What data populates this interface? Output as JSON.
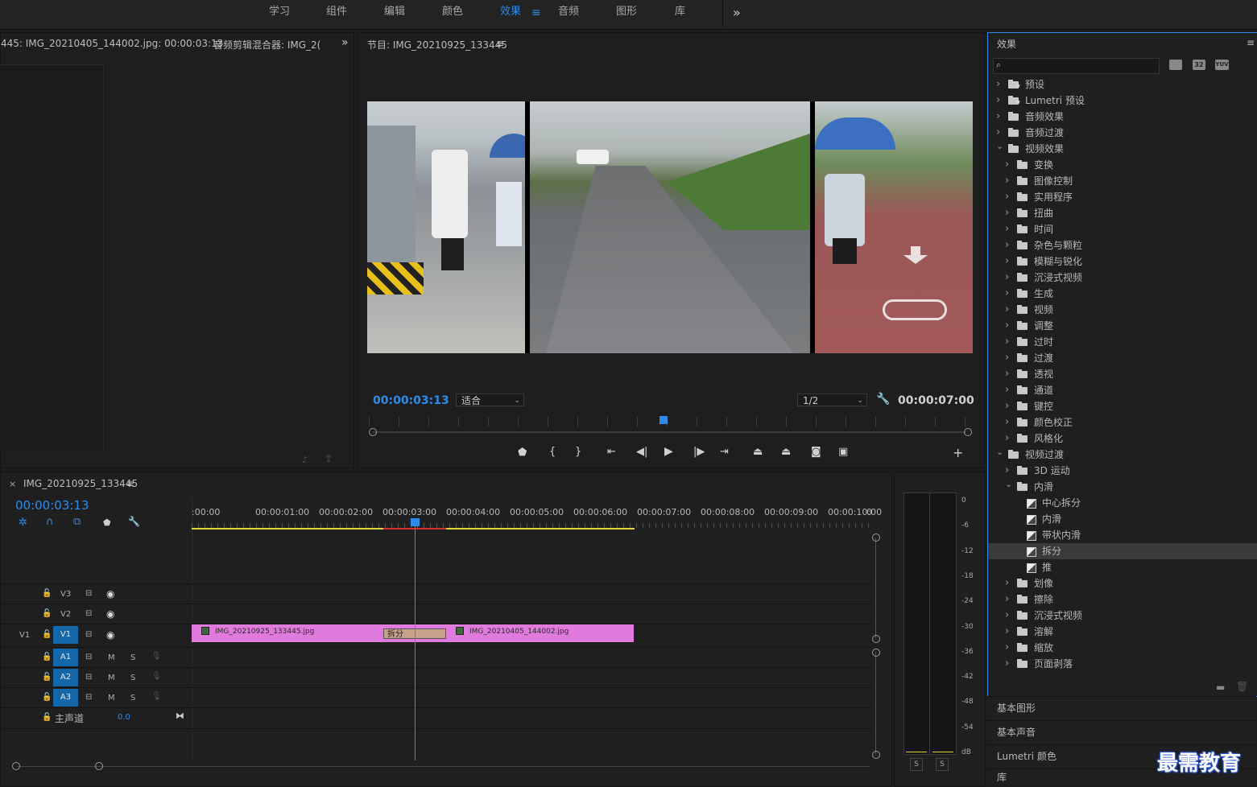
{
  "workspace": {
    "tabs": [
      "学习",
      "组件",
      "编辑",
      "颜色",
      "效果",
      "音频",
      "图形",
      "库"
    ],
    "active": "效果"
  },
  "source_panel": {
    "tab1": "445: IMG_20210405_144002.jpg: 00:00:03:13",
    "tab2": "音频剪辑混合器: IMG_2("
  },
  "program": {
    "title": "节目: IMG_20210925_133445",
    "timecode": "00:00:03:13",
    "zoom": "适合",
    "resolution": "1/2",
    "duration": "00:00:07:00",
    "playhead_fraction": 0.49
  },
  "effects": {
    "title": "效果",
    "search_placeholder": "",
    "filter_buttons": [
      "32",
      "YUV"
    ],
    "tree": [
      {
        "label": "预设",
        "level": 0,
        "kind": "preset-folder",
        "expanded": false
      },
      {
        "label": "Lumetri 预设",
        "level": 0,
        "kind": "preset-folder",
        "expanded": false
      },
      {
        "label": "音频效果",
        "level": 0,
        "kind": "folder",
        "expanded": false
      },
      {
        "label": "音频过渡",
        "level": 0,
        "kind": "folder",
        "expanded": false
      },
      {
        "label": "视频效果",
        "level": 0,
        "kind": "folder",
        "expanded": true
      },
      {
        "label": "变换",
        "level": 1,
        "kind": "folder",
        "expanded": false
      },
      {
        "label": "图像控制",
        "level": 1,
        "kind": "folder",
        "expanded": false
      },
      {
        "label": "实用程序",
        "level": 1,
        "kind": "folder",
        "expanded": false
      },
      {
        "label": "扭曲",
        "level": 1,
        "kind": "folder",
        "expanded": false
      },
      {
        "label": "时间",
        "level": 1,
        "kind": "folder",
        "expanded": false
      },
      {
        "label": "杂色与颗粒",
        "level": 1,
        "kind": "folder",
        "expanded": false
      },
      {
        "label": "模糊与锐化",
        "level": 1,
        "kind": "folder",
        "expanded": false
      },
      {
        "label": "沉浸式视频",
        "level": 1,
        "kind": "folder",
        "expanded": false
      },
      {
        "label": "生成",
        "level": 1,
        "kind": "folder",
        "expanded": false
      },
      {
        "label": "视频",
        "level": 1,
        "kind": "folder",
        "expanded": false
      },
      {
        "label": "调整",
        "level": 1,
        "kind": "folder",
        "expanded": false
      },
      {
        "label": "过时",
        "level": 1,
        "kind": "folder",
        "expanded": false
      },
      {
        "label": "过渡",
        "level": 1,
        "kind": "folder",
        "expanded": false
      },
      {
        "label": "透视",
        "level": 1,
        "kind": "folder",
        "expanded": false
      },
      {
        "label": "通道",
        "level": 1,
        "kind": "folder",
        "expanded": false
      },
      {
        "label": "键控",
        "level": 1,
        "kind": "folder",
        "expanded": false
      },
      {
        "label": "颜色校正",
        "level": 1,
        "kind": "folder",
        "expanded": false
      },
      {
        "label": "风格化",
        "level": 1,
        "kind": "folder",
        "expanded": false
      },
      {
        "label": "视频过渡",
        "level": 0,
        "kind": "folder",
        "expanded": true
      },
      {
        "label": "3D 运动",
        "level": 1,
        "kind": "folder",
        "expanded": false
      },
      {
        "label": "内滑",
        "level": 1,
        "kind": "folder",
        "expanded": true
      },
      {
        "label": "中心拆分",
        "level": 2,
        "kind": "effect"
      },
      {
        "label": "内滑",
        "level": 2,
        "kind": "effect"
      },
      {
        "label": "带状内滑",
        "level": 2,
        "kind": "effect"
      },
      {
        "label": "拆分",
        "level": 2,
        "kind": "effect",
        "selected": true
      },
      {
        "label": "推",
        "level": 2,
        "kind": "effect"
      },
      {
        "label": "划像",
        "level": 1,
        "kind": "folder",
        "expanded": false
      },
      {
        "label": "擦除",
        "level": 1,
        "kind": "folder",
        "expanded": false
      },
      {
        "label": "沉浸式视频",
        "level": 1,
        "kind": "folder",
        "expanded": false
      },
      {
        "label": "溶解",
        "level": 1,
        "kind": "folder",
        "expanded": false
      },
      {
        "label": "缩放",
        "level": 1,
        "kind": "folder",
        "expanded": false
      },
      {
        "label": "页面剥落",
        "level": 1,
        "kind": "folder",
        "expanded": false
      }
    ]
  },
  "side_panels": [
    "基本图形",
    "基本声音",
    "Lumetri 颜色",
    "库"
  ],
  "timeline": {
    "title": "IMG_20210925_133445",
    "timecode": "00:00:03:13",
    "ruler": [
      ":00:00",
      "00:00:01:00",
      "00:00:02:00",
      "00:00:03:00",
      "00:00:04:00",
      "00:00:05:00",
      "00:00:06:00",
      "00:00:07:00",
      "00:00:08:00",
      "00:00:09:00",
      "00:00:10:00",
      "0"
    ],
    "tracks": {
      "video": [
        "V3",
        "V2",
        "V1"
      ],
      "source_v": "V1",
      "audio": [
        "A1",
        "A2",
        "A3"
      ],
      "audio_buttons": [
        "M",
        "S"
      ],
      "master": "主声道",
      "master_value": "0.0"
    },
    "clips": [
      {
        "name": "IMG_20210925_133445.jpg"
      },
      {
        "name": "IMG_20210405_144002.jpg"
      }
    ],
    "transition": "拆分"
  },
  "meters": {
    "db_scale": [
      "0",
      "-6",
      "-12",
      "-18",
      "-24",
      "-30",
      "-36",
      "-42",
      "-48",
      "-54",
      "dB"
    ],
    "solo_buttons": [
      "S",
      "S"
    ]
  },
  "watermark": "最需教育",
  "colors": {
    "accent": "#2d8ceb",
    "clip": "#e07adc",
    "track_target": "#1467a8",
    "work_area": "#e2d43a",
    "render_red": "#d2332c"
  }
}
